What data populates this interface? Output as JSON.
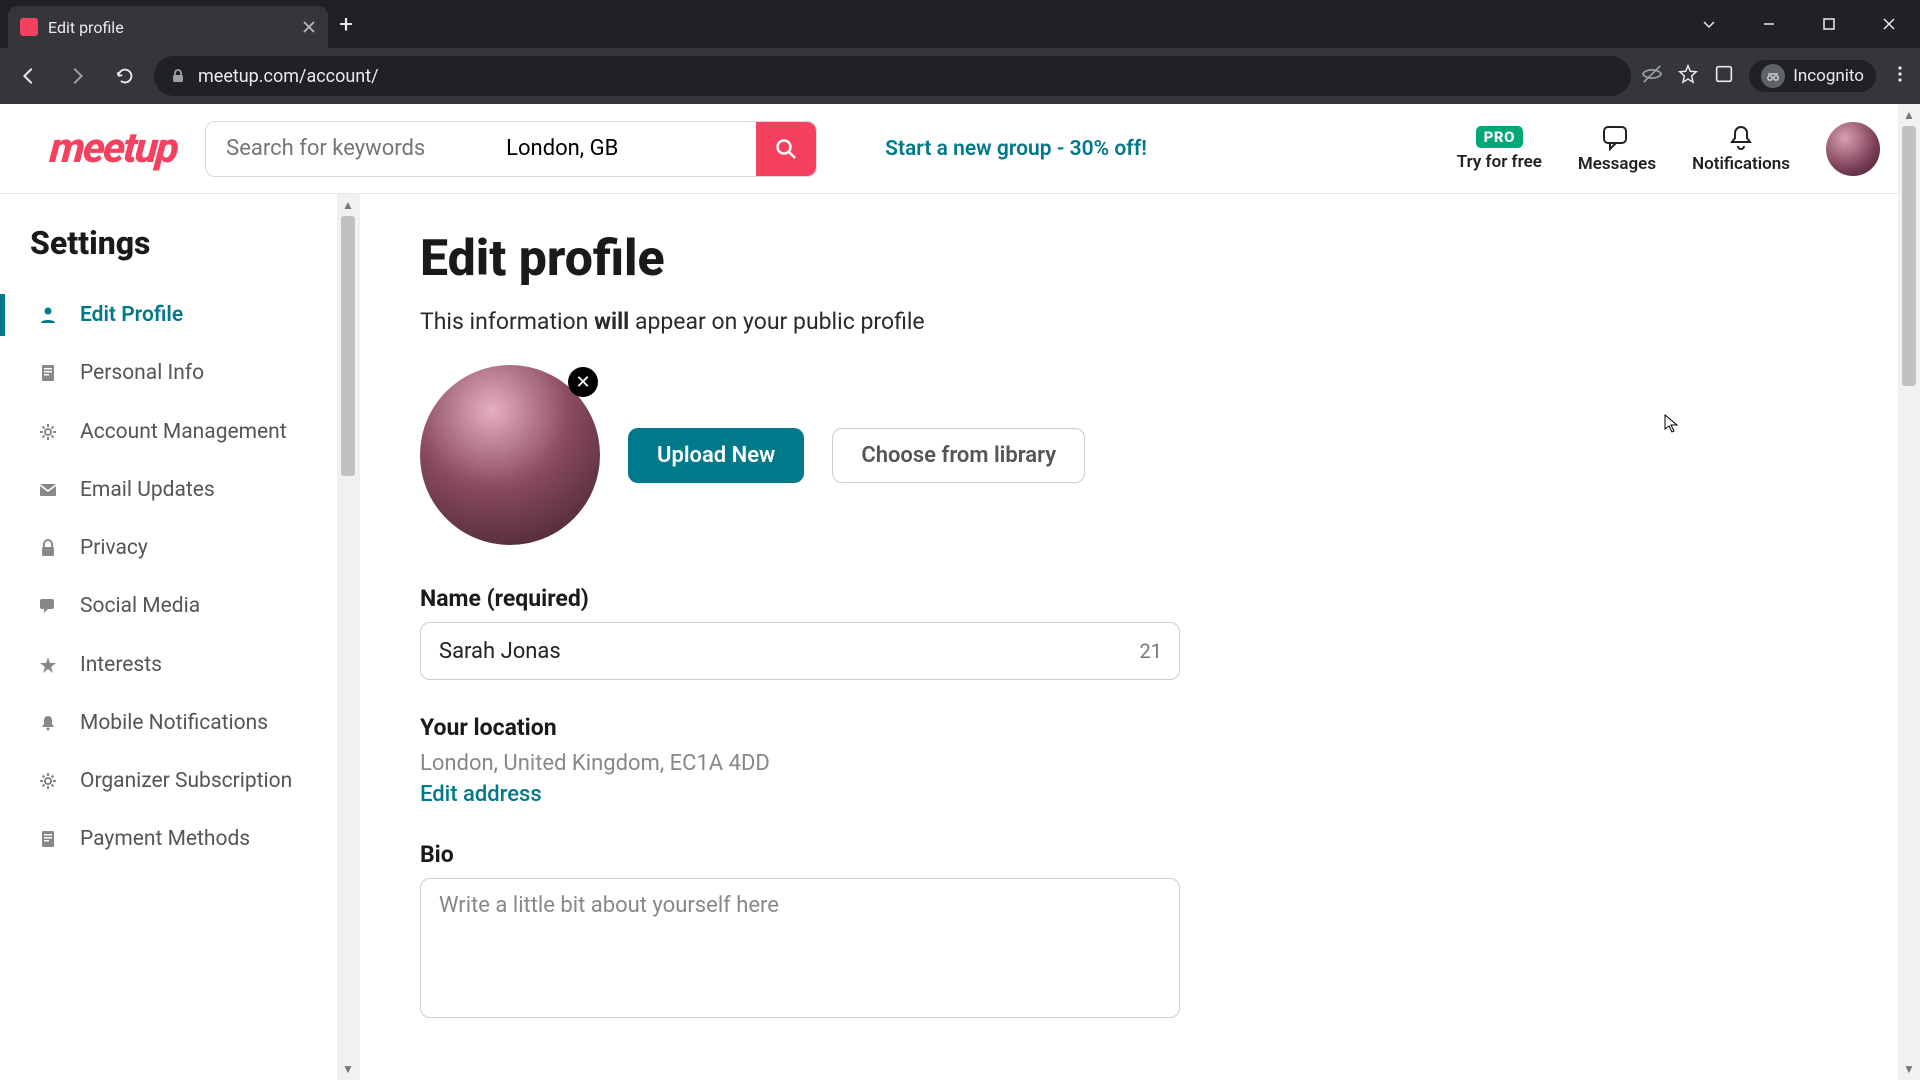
{
  "browser": {
    "tab_title": "Edit profile",
    "url": "meetup.com/account/",
    "incognito_label": "Incognito"
  },
  "header": {
    "logo_text": "meetup",
    "search_placeholder": "Search for keywords",
    "location_value": "London, GB",
    "promo_text": "Start a new group - 30% off!",
    "pro_badge": "PRO",
    "try_free_label": "Try for free",
    "messages_label": "Messages",
    "notifications_label": "Notifications"
  },
  "sidebar": {
    "heading": "Settings",
    "items": [
      {
        "label": "Edit Profile",
        "icon": "person"
      },
      {
        "label": "Personal Info",
        "icon": "doc"
      },
      {
        "label": "Account Management",
        "icon": "gear"
      },
      {
        "label": "Email Updates",
        "icon": "mail"
      },
      {
        "label": "Privacy",
        "icon": "lock"
      },
      {
        "label": "Social Media",
        "icon": "chat"
      },
      {
        "label": "Interests",
        "icon": "star"
      },
      {
        "label": "Mobile Notifications",
        "icon": "bell"
      },
      {
        "label": "Organizer Subscription",
        "icon": "gear"
      },
      {
        "label": "Payment Methods",
        "icon": "doc"
      }
    ]
  },
  "main": {
    "title": "Edit profile",
    "subtitle_pre": "This information ",
    "subtitle_bold": "will",
    "subtitle_post": " appear on your public profile",
    "upload_label": "Upload New",
    "choose_label": "Choose from library",
    "name_label": "Name (required)",
    "name_value": "Sarah Jonas",
    "name_counter": "21",
    "location_label": "Your location",
    "location_value": "London, United Kingdom, EC1A 4DD",
    "edit_address_label": "Edit address",
    "bio_label": "Bio",
    "bio_placeholder": "Write a little bit about yourself here"
  }
}
